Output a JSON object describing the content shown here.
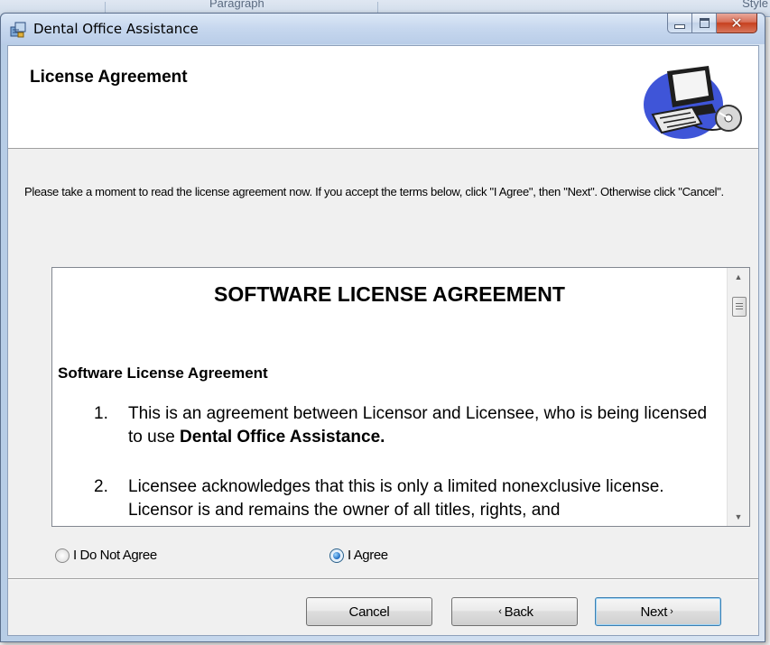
{
  "background": {
    "ribbon_fragment_left": "Paragraph",
    "ribbon_fragment_right": "Style"
  },
  "window": {
    "title": "Dental Office Assistance",
    "controls": {
      "minimize": "minimize-icon",
      "maximize": "maximize-icon",
      "close": "close-icon"
    }
  },
  "banner": {
    "title": "License Agreement",
    "art": "computer-cd-icon"
  },
  "instructions": "Please take a moment to read the license agreement now. If you accept the terms below, click \"I Agree\", then \"Next\". Otherwise click \"Cancel\".",
  "license": {
    "heading": "SOFTWARE LICENSE AGREEMENT",
    "subheading": "Software License Agreement",
    "items": [
      {
        "num": "1.",
        "text_before": "This is an agreement between Licensor and Licensee, who is being licensed to use ",
        "text_bold": "Dental Office Assistance."
      },
      {
        "num": "2.",
        "text": "Licensee acknowledges that this is only a limited nonexclusive license.  Licensor is and remains the owner of all titles, rights, and"
      }
    ]
  },
  "options": {
    "disagree": "I Do Not Agree",
    "agree": "I Agree",
    "selected": "agree"
  },
  "buttons": {
    "cancel": "Cancel",
    "back": "Back",
    "next": "Next"
  },
  "colors": {
    "close_button": "#c7401e",
    "radio_selected": "#1d6ac0",
    "default_button_border": "#3c7fb1"
  }
}
